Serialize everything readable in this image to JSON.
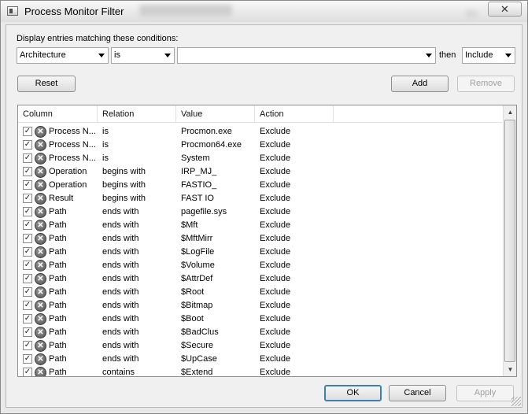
{
  "window": {
    "title": "Process Monitor Filter",
    "close_glyph": "✕"
  },
  "filter": {
    "prompt": "Display entries matching these conditions:",
    "column_value": "Architecture",
    "relation_value": "is",
    "value_text": "",
    "then_label": "then",
    "action_value": "Include"
  },
  "buttons": {
    "reset": "Reset",
    "add": "Add",
    "remove": "Remove",
    "ok": "OK",
    "cancel": "Cancel",
    "apply": "Apply"
  },
  "list": {
    "headers": [
      "Column",
      "Relation",
      "Value",
      "Action"
    ],
    "rows": [
      {
        "checked": true,
        "column": "Process N...",
        "relation": "is",
        "value": "Procmon.exe",
        "action": "Exclude"
      },
      {
        "checked": true,
        "column": "Process N...",
        "relation": "is",
        "value": "Procmon64.exe",
        "action": "Exclude"
      },
      {
        "checked": true,
        "column": "Process N...",
        "relation": "is",
        "value": "System",
        "action": "Exclude"
      },
      {
        "checked": true,
        "column": "Operation",
        "relation": "begins with",
        "value": "IRP_MJ_",
        "action": "Exclude"
      },
      {
        "checked": true,
        "column": "Operation",
        "relation": "begins with",
        "value": "FASTIO_",
        "action": "Exclude"
      },
      {
        "checked": true,
        "column": "Result",
        "relation": "begins with",
        "value": "FAST IO",
        "action": "Exclude"
      },
      {
        "checked": true,
        "column": "Path",
        "relation": "ends with",
        "value": "pagefile.sys",
        "action": "Exclude"
      },
      {
        "checked": true,
        "column": "Path",
        "relation": "ends with",
        "value": "$Mft",
        "action": "Exclude"
      },
      {
        "checked": true,
        "column": "Path",
        "relation": "ends with",
        "value": "$MftMirr",
        "action": "Exclude"
      },
      {
        "checked": true,
        "column": "Path",
        "relation": "ends with",
        "value": "$LogFile",
        "action": "Exclude"
      },
      {
        "checked": true,
        "column": "Path",
        "relation": "ends with",
        "value": "$Volume",
        "action": "Exclude"
      },
      {
        "checked": true,
        "column": "Path",
        "relation": "ends with",
        "value": "$AttrDef",
        "action": "Exclude"
      },
      {
        "checked": true,
        "column": "Path",
        "relation": "ends with",
        "value": "$Root",
        "action": "Exclude"
      },
      {
        "checked": true,
        "column": "Path",
        "relation": "ends with",
        "value": "$Bitmap",
        "action": "Exclude"
      },
      {
        "checked": true,
        "column": "Path",
        "relation": "ends with",
        "value": "$Boot",
        "action": "Exclude"
      },
      {
        "checked": true,
        "column": "Path",
        "relation": "ends with",
        "value": "$BadClus",
        "action": "Exclude"
      },
      {
        "checked": true,
        "column": "Path",
        "relation": "ends with",
        "value": "$Secure",
        "action": "Exclude"
      },
      {
        "checked": true,
        "column": "Path",
        "relation": "ends with",
        "value": "$UpCase",
        "action": "Exclude"
      },
      {
        "checked": true,
        "column": "Path",
        "relation": "contains",
        "value": "$Extend",
        "action": "Exclude"
      }
    ],
    "check_glyph": "✓",
    "exclude_icon_glyph": "✕",
    "scroll_up_glyph": "▲",
    "scroll_down_glyph": "▼"
  },
  "icons": {
    "app": "process-monitor-icon",
    "close": "close-icon",
    "exclude": "exclude-icon",
    "dropdown": "chevron-down-icon"
  }
}
